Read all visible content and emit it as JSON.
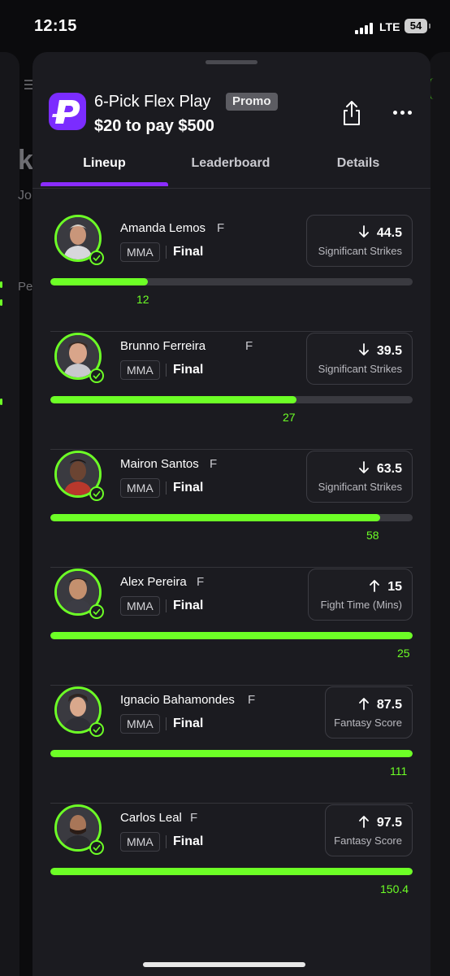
{
  "status_bar": {
    "time": "12:15",
    "network": "LTE",
    "battery": "54"
  },
  "background": {
    "title_fragment": "k",
    "sub_fragment": "Jo",
    "label_fragment": "Pe"
  },
  "header": {
    "title": "6-Pick Flex Play",
    "badge": "Promo",
    "subtitle": "$20 to pay $500",
    "share_icon": "share-icon",
    "more_icon": "more-horizontal-icon"
  },
  "tabs": [
    {
      "label": "Lineup",
      "active": true
    },
    {
      "label": "Leaderboard",
      "active": false
    },
    {
      "label": "Details",
      "active": false
    }
  ],
  "picks": [
    {
      "name": "Amanda Lemos",
      "position": "F",
      "league": "MMA",
      "status": "Final",
      "direction": "down",
      "line": "44.5",
      "stat": "Significant Strikes",
      "actual": "12",
      "progress": 0.27
    },
    {
      "name": "Brunno Ferreira",
      "position": "F",
      "league": "MMA",
      "status": "Final",
      "direction": "down",
      "line": "39.5",
      "stat": "Significant Strikes",
      "actual": "27",
      "progress": 0.68
    },
    {
      "name": "Mairon Santos",
      "position": "F",
      "league": "MMA",
      "status": "Final",
      "direction": "down",
      "line": "63.5",
      "stat": "Significant Strikes",
      "actual": "58",
      "progress": 0.91
    },
    {
      "name": "Alex Pereira",
      "position": "F",
      "league": "MMA",
      "status": "Final",
      "direction": "up",
      "line": "15",
      "stat": "Fight Time (Mins)",
      "actual": "25",
      "progress": 1.0
    },
    {
      "name": "Ignacio Bahamondes",
      "position": "F",
      "league": "MMA",
      "status": "Final",
      "direction": "up",
      "line": "87.5",
      "stat": "Fantasy Score",
      "actual": "111",
      "progress": 1.0
    },
    {
      "name": "Carlos Leal",
      "position": "F",
      "league": "MMA",
      "status": "Final",
      "direction": "up",
      "line": "97.5",
      "stat": "Fantasy Score",
      "actual": "150.4",
      "progress": 1.0
    }
  ],
  "colors": {
    "accent_green": "#6dff26",
    "accent_purple": "#8a2cff",
    "sheet_bg": "#1b1b20"
  }
}
